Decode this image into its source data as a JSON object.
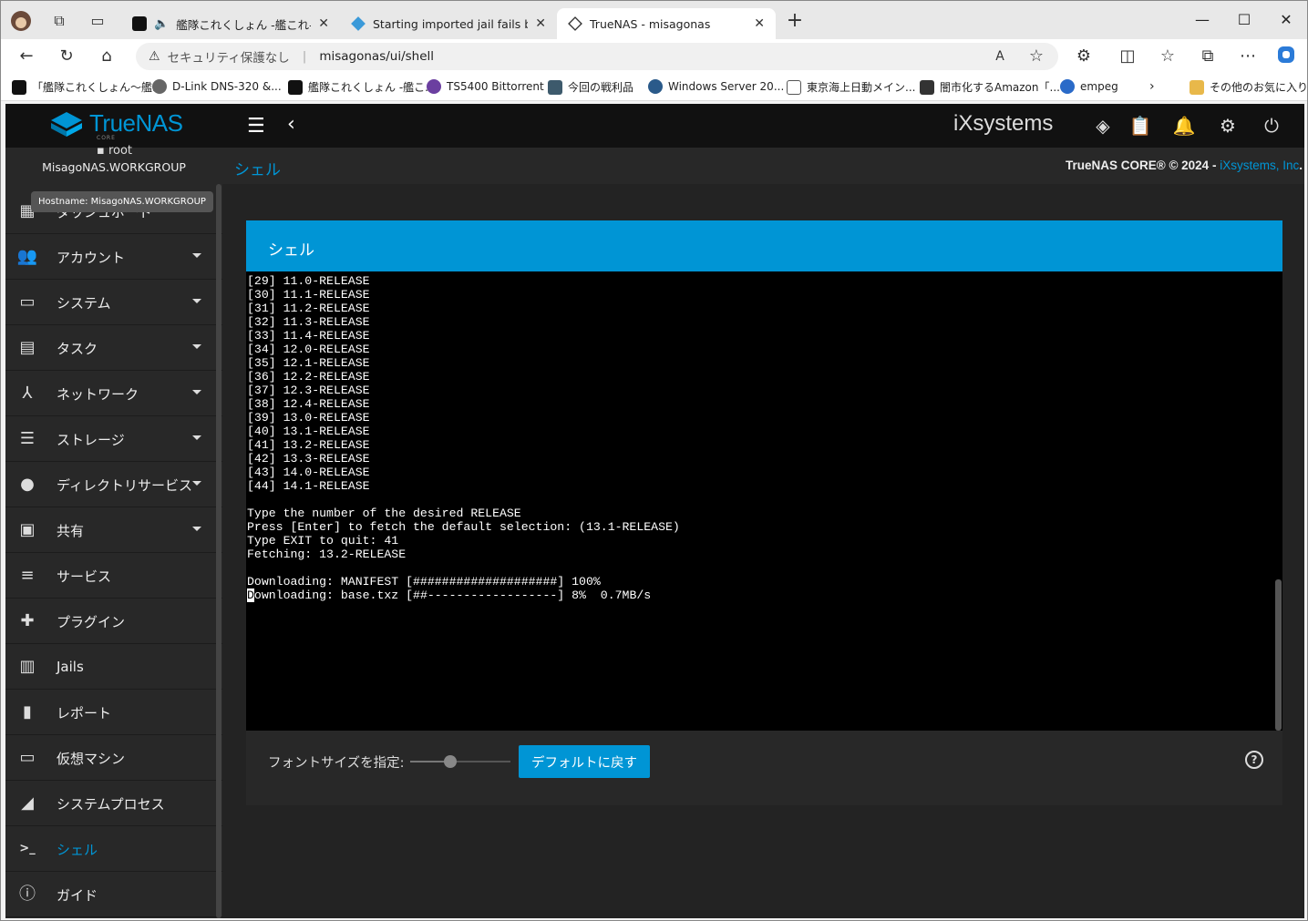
{
  "browser": {
    "tabs": [
      {
        "title": "艦隊これくしょん -艦これ- - オン",
        "active": false
      },
      {
        "title": "Starting imported jail fails becaus",
        "active": false
      },
      {
        "title": "TrueNAS - misagonas",
        "active": true
      }
    ],
    "security_label": "セキュリティ保護なし",
    "url": "misagonas/ui/shell",
    "bookmarks": [
      "「艦隊これくしょん〜艦...",
      "D-Link DNS-320 &...",
      "艦隊これくしょん -艦こ...",
      "TS5400 Bittorrent",
      "今回の戦利品",
      "Windows Server 20...",
      "東京海上日動メイン...",
      "闇市化するAmazon「...",
      "empeg",
      "その他のお気に入り"
    ]
  },
  "app": {
    "logo": "TrueNAS",
    "logo_edition": "CORE",
    "vendor": "iXsystems",
    "breadcrumb": "シェル",
    "copyright_prefix": "TrueNAS CORE® © 2024 - ",
    "copyright_link": "iXsystems, Inc",
    "copyright_suffix": "."
  },
  "sidebar": {
    "user": "root",
    "hostname": "MisagoNAS.WORKGROUP",
    "tooltip": "Hostname: MisagoNAS.WORKGROUP",
    "items": [
      {
        "label": "ダッシュボード",
        "icon": "dashboard-icon",
        "caret": false
      },
      {
        "label": "アカウント",
        "icon": "people-icon",
        "caret": true
      },
      {
        "label": "システム",
        "icon": "computer-icon",
        "caret": true
      },
      {
        "label": "タスク",
        "icon": "calendar-icon",
        "caret": true
      },
      {
        "label": "ネットワーク",
        "icon": "network-icon",
        "caret": true
      },
      {
        "label": "ストレージ",
        "icon": "storage-icon",
        "caret": true
      },
      {
        "label": "ディレクトリサービス",
        "icon": "directory-icon",
        "caret": true
      },
      {
        "label": "共有",
        "icon": "folder-shared-icon",
        "caret": true
      },
      {
        "label": "サービス",
        "icon": "tune-icon",
        "caret": false
      },
      {
        "label": "プラグイン",
        "icon": "puzzle-icon",
        "caret": false
      },
      {
        "label": "Jails",
        "icon": "jail-icon",
        "caret": false
      },
      {
        "label": "レポート",
        "icon": "chart-icon",
        "caret": false
      },
      {
        "label": "仮想マシン",
        "icon": "monitor-icon",
        "caret": false
      },
      {
        "label": "システムプロセス",
        "icon": "process-icon",
        "caret": false
      },
      {
        "label": "シェル",
        "icon": "terminal-icon",
        "caret": false,
        "active": true
      },
      {
        "label": "ガイド",
        "icon": "info-icon",
        "caret": false
      }
    ]
  },
  "shell": {
    "title": "シェル",
    "lines": [
      "[29] 11.0-RELEASE",
      "[30] 11.1-RELEASE",
      "[31] 11.2-RELEASE",
      "[32] 11.3-RELEASE",
      "[33] 11.4-RELEASE",
      "[34] 12.0-RELEASE",
      "[35] 12.1-RELEASE",
      "[36] 12.2-RELEASE",
      "[37] 12.3-RELEASE",
      "[38] 12.4-RELEASE",
      "[39] 13.0-RELEASE",
      "[40] 13.1-RELEASE",
      "[41] 13.2-RELEASE",
      "[42] 13.3-RELEASE",
      "[43] 14.0-RELEASE",
      "[44] 14.1-RELEASE",
      "",
      "Type the number of the desired RELEASE",
      "Press [Enter] to fetch the default selection: (13.1-RELEASE)",
      "Type EXIT to quit: 41",
      "Fetching: 13.2-RELEASE",
      "",
      "Downloading: MANIFEST [####################] 100%"
    ],
    "last_line_cursor_char": "D",
    "last_line_rest": "ownloading: base.txz [##------------------] 8%  0.7MB/s",
    "font_size_label": "フォントサイズを指定:",
    "font_size_level": 0.4,
    "reset_button": "デフォルトに戻す"
  },
  "colors": {
    "accent": "#0095d5",
    "terminal_bg": "#000000",
    "sidebar_bg": "#282828"
  }
}
